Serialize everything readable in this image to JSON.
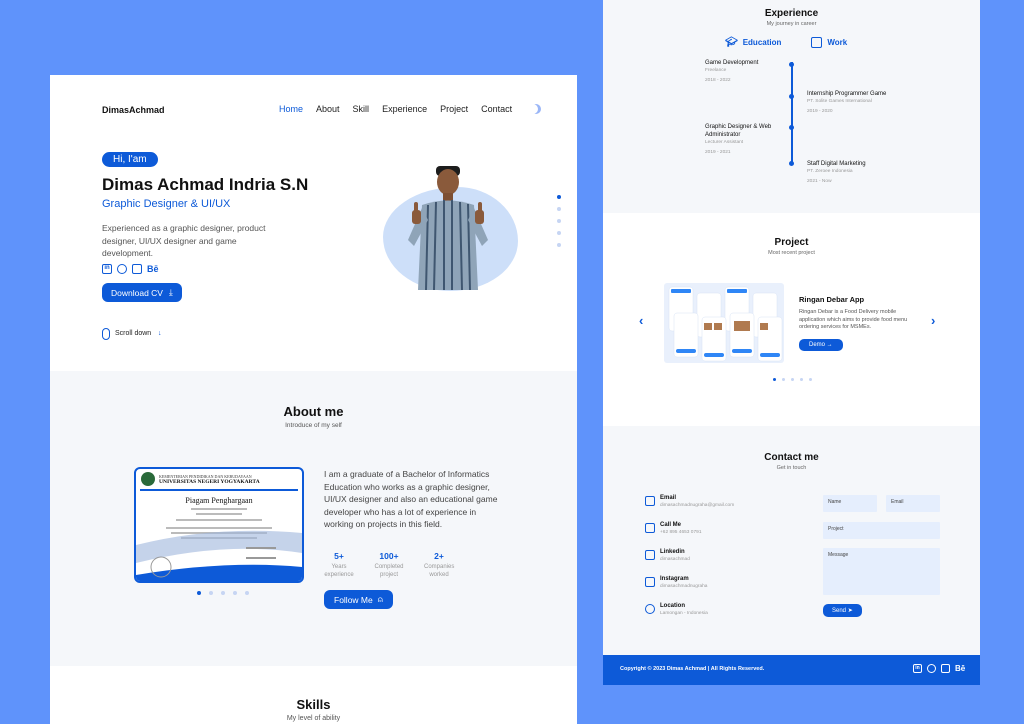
{
  "left": {
    "logo": "DimasAchmad",
    "nav": [
      "Home",
      "About",
      "Skill",
      "Experience",
      "Project",
      "Contact"
    ],
    "hero": {
      "greeting": "Hi, I'am",
      "name": "Dimas Achmad Indria S.N",
      "role": "Graphic Designer & UI/UX",
      "description": "Experienced as a graphic designer, product designer, UI/UX designer and game development.",
      "cv_button": "Download CV",
      "scroll_label": "Scroll down"
    },
    "about": {
      "title": "About me",
      "subtitle": "Introduce of my self",
      "text": "I am a graduate of a Bachelor of Informatics Education who works as a graphic designer, UI/UX designer and also an educational game developer who has a lot of experience in working on projects in this field.",
      "stats": [
        {
          "num": "5+",
          "label": "Years experience"
        },
        {
          "num": "100+",
          "label": "Completed project"
        },
        {
          "num": "2+",
          "label": "Companies worked"
        }
      ],
      "follow_button": "Follow Me",
      "certificate": {
        "ministry": "KEMENTERIAN PENDIDIKAN DAN KEBUDAYAAN",
        "university": "UNIVERSITAS NEGERI YOGYAKARTA",
        "heading": "Piagam Penghargaan"
      }
    },
    "skills": {
      "title": "Skills",
      "subtitle": "My level of ability"
    }
  },
  "right": {
    "experience": {
      "title": "Experience",
      "subtitle": "My journey in career",
      "tabs": [
        "Education",
        "Work"
      ],
      "items": [
        {
          "title": "Game Development",
          "sub": "Freelance",
          "date": "2018 - 2022"
        },
        {
          "title": "Internship Programmer Game",
          "sub": "PT. Solite Games International",
          "date": "2019 - 2020"
        },
        {
          "title": "Graphic Designer & Web Administrator",
          "sub": "Lecturer Assistant",
          "date": "2019 - 2021"
        },
        {
          "title": "Staff Digital Marketing",
          "sub": "PT. Zeroee Indonesia",
          "date": "2021 - Now"
        }
      ]
    },
    "project": {
      "title": "Project",
      "subtitle": "Most recent project",
      "name": "Ringan Debar App",
      "description": "Ringan Debar is a Food Delivery mobile application which aims to provide food menu ordering services for MSMEs.",
      "demo_button": "Demo →"
    },
    "contact": {
      "title": "Contact me",
      "subtitle": "Get in touch",
      "items": [
        {
          "label": "Email",
          "value": "dimasachmadnugraha@gmail.com",
          "icon": "mail-icon"
        },
        {
          "label": "Call Me",
          "value": "+62 895 4653 0791",
          "icon": "phone-icon"
        },
        {
          "label": "Linkedin",
          "value": "dimasachmad",
          "icon": "linkedin-icon"
        },
        {
          "label": "Instagram",
          "value": "dimasachmadnugraha",
          "icon": "instagram-icon"
        },
        {
          "label": "Location",
          "value": "Lamongan - Indonesia",
          "icon": "location-icon"
        }
      ],
      "form": {
        "name": "Name",
        "email": "Email",
        "project": "Project",
        "message": "Message",
        "send": "Send"
      }
    },
    "footer": {
      "copyright": "Copyright © 2023 Dimas Achmad | All Rights Reserved."
    }
  },
  "colors": {
    "accent": "#0d5ad8",
    "background": "#5f93fb"
  }
}
